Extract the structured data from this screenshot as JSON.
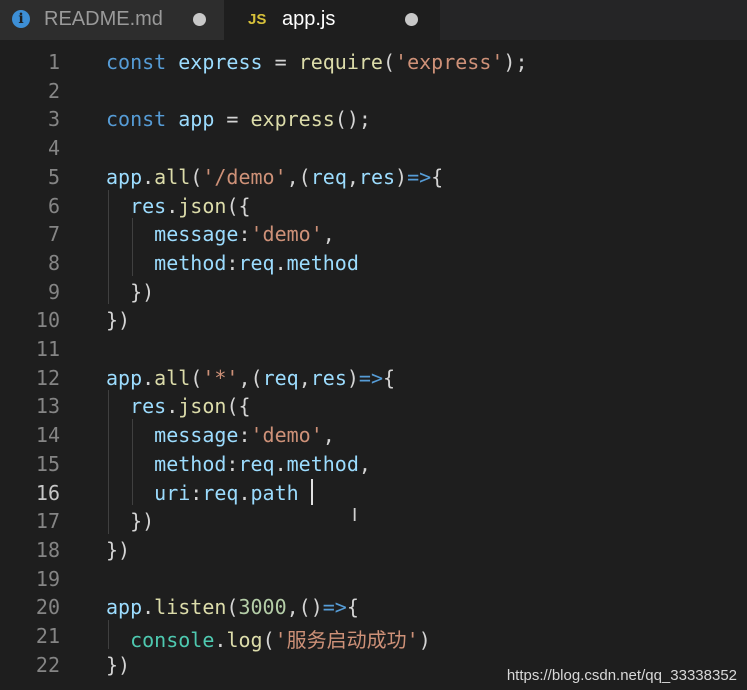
{
  "tabs": [
    {
      "label": "README.md",
      "icon": "info-icon",
      "active": false,
      "dirty": true
    },
    {
      "label": "app.js",
      "icon_text": "JS",
      "active": true,
      "dirty": true
    }
  ],
  "editor": {
    "active_line": 16,
    "lines": [
      {
        "n": "1",
        "tokens": [
          [
            "keyword",
            "const"
          ],
          [
            "punc",
            " "
          ],
          [
            "var",
            "express"
          ],
          [
            "op",
            " = "
          ],
          [
            "func",
            "require"
          ],
          [
            "punc",
            "("
          ],
          [
            "str",
            "'express'"
          ],
          [
            "punc",
            ");"
          ]
        ]
      },
      {
        "n": "2",
        "tokens": []
      },
      {
        "n": "3",
        "tokens": [
          [
            "keyword",
            "const"
          ],
          [
            "punc",
            " "
          ],
          [
            "var",
            "app"
          ],
          [
            "op",
            " = "
          ],
          [
            "func",
            "express"
          ],
          [
            "punc",
            "();"
          ]
        ]
      },
      {
        "n": "4",
        "tokens": []
      },
      {
        "n": "5",
        "tokens": [
          [
            "var",
            "app"
          ],
          [
            "punc",
            "."
          ],
          [
            "func",
            "all"
          ],
          [
            "punc",
            "("
          ],
          [
            "str",
            "'/demo'"
          ],
          [
            "punc",
            ",("
          ],
          [
            "var",
            "req"
          ],
          [
            "punc",
            ","
          ],
          [
            "var",
            "res"
          ],
          [
            "punc",
            ")"
          ],
          [
            "arrow",
            "=>"
          ],
          [
            "punc",
            "{"
          ]
        ]
      },
      {
        "n": "6",
        "tokens": [
          [
            "punc",
            "  "
          ],
          [
            "var",
            "res"
          ],
          [
            "punc",
            "."
          ],
          [
            "func",
            "json"
          ],
          [
            "punc",
            "({"
          ]
        ]
      },
      {
        "n": "7",
        "tokens": [
          [
            "punc",
            "    "
          ],
          [
            "prop",
            "message"
          ],
          [
            "punc",
            ":"
          ],
          [
            "str",
            "'demo'"
          ],
          [
            "punc",
            ","
          ]
        ]
      },
      {
        "n": "8",
        "tokens": [
          [
            "punc",
            "    "
          ],
          [
            "prop",
            "method"
          ],
          [
            "punc",
            ":"
          ],
          [
            "var",
            "req"
          ],
          [
            "punc",
            "."
          ],
          [
            "prop",
            "method"
          ]
        ]
      },
      {
        "n": "9",
        "tokens": [
          [
            "punc",
            "  })"
          ]
        ]
      },
      {
        "n": "10",
        "tokens": [
          [
            "punc",
            "})"
          ]
        ]
      },
      {
        "n": "11",
        "tokens": []
      },
      {
        "n": "12",
        "tokens": [
          [
            "var",
            "app"
          ],
          [
            "punc",
            "."
          ],
          [
            "func",
            "all"
          ],
          [
            "punc",
            "("
          ],
          [
            "str",
            "'*'"
          ],
          [
            "punc",
            ",("
          ],
          [
            "var",
            "req"
          ],
          [
            "punc",
            ","
          ],
          [
            "var",
            "res"
          ],
          [
            "punc",
            ")"
          ],
          [
            "arrow",
            "=>"
          ],
          [
            "punc",
            "{"
          ]
        ]
      },
      {
        "n": "13",
        "tokens": [
          [
            "punc",
            "  "
          ],
          [
            "var",
            "res"
          ],
          [
            "punc",
            "."
          ],
          [
            "func",
            "json"
          ],
          [
            "punc",
            "({"
          ]
        ]
      },
      {
        "n": "14",
        "tokens": [
          [
            "punc",
            "    "
          ],
          [
            "prop",
            "message"
          ],
          [
            "punc",
            ":"
          ],
          [
            "str",
            "'demo'"
          ],
          [
            "punc",
            ","
          ]
        ]
      },
      {
        "n": "15",
        "tokens": [
          [
            "punc",
            "    "
          ],
          [
            "prop",
            "method"
          ],
          [
            "punc",
            ":"
          ],
          [
            "var",
            "req"
          ],
          [
            "punc",
            "."
          ],
          [
            "prop",
            "method"
          ],
          [
            "punc",
            ","
          ]
        ]
      },
      {
        "n": "16",
        "tokens": [
          [
            "punc",
            "    "
          ],
          [
            "prop",
            "uri"
          ],
          [
            "punc",
            ":"
          ],
          [
            "var",
            "req"
          ],
          [
            "punc",
            "."
          ],
          [
            "prop",
            "path"
          ]
        ]
      },
      {
        "n": "17",
        "tokens": [
          [
            "punc",
            "  })"
          ]
        ]
      },
      {
        "n": "18",
        "tokens": [
          [
            "punc",
            "})"
          ]
        ]
      },
      {
        "n": "19",
        "tokens": []
      },
      {
        "n": "20",
        "tokens": [
          [
            "var",
            "app"
          ],
          [
            "punc",
            "."
          ],
          [
            "func",
            "listen"
          ],
          [
            "punc",
            "("
          ],
          [
            "num",
            "3000"
          ],
          [
            "punc",
            ",()"
          ],
          [
            "arrow",
            "=>"
          ],
          [
            "punc",
            "{"
          ]
        ]
      },
      {
        "n": "21",
        "tokens": [
          [
            "punc",
            "  "
          ],
          [
            "class",
            "console"
          ],
          [
            "punc",
            "."
          ],
          [
            "func",
            "log"
          ],
          [
            "punc",
            "("
          ],
          [
            "str",
            "'服务启动成功'"
          ],
          [
            "punc",
            ")"
          ]
        ]
      },
      {
        "n": "22",
        "tokens": [
          [
            "punc",
            "})"
          ]
        ]
      }
    ]
  },
  "watermark": "https://blog.csdn.net/qq_33338352",
  "colors": {
    "background": "#1e1e1e",
    "tabbar": "#252526",
    "keyword": "#569cd6",
    "variable": "#9cdcfe",
    "function": "#dcdcaa",
    "string": "#ce9178",
    "number": "#b5cea8",
    "class": "#4ec9b0"
  }
}
